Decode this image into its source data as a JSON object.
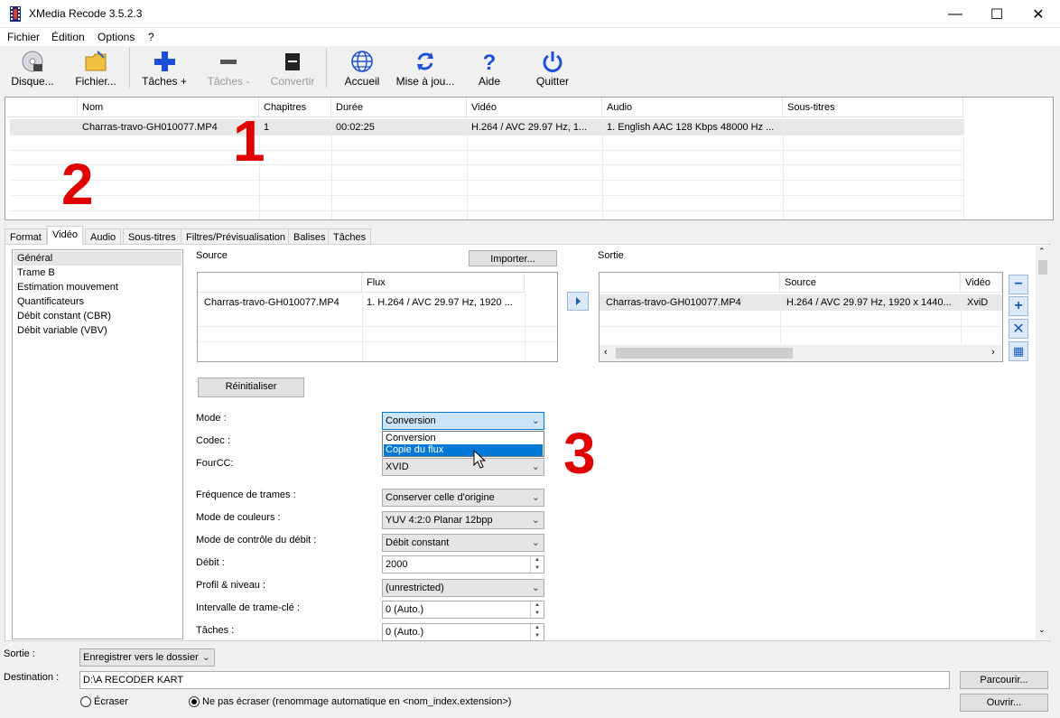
{
  "window": {
    "title": "XMedia Recode 3.5.2.3",
    "minimize": "—",
    "maximize": "☐",
    "close": "✕"
  },
  "menu": [
    "Fichier",
    "Édition",
    "Options",
    "?"
  ],
  "toolbar": {
    "disc": "Disque...",
    "file": "Fichier...",
    "add_task": "Tâches +",
    "remove_task": "Tâches -",
    "convert": "Convertir",
    "home": "Accueil",
    "update": "Mise à jou...",
    "help": "Aide",
    "quit": "Quitter"
  },
  "filelist": {
    "headers": [
      "Nom",
      "Chapitres",
      "Durée",
      "Vidéo",
      "Audio",
      "Sous-titres"
    ],
    "rows": [
      [
        "Charras-travo-GH010077.MP4",
        "1",
        "00:02:25",
        "H.264 / AVC  29.97 Hz, 1...",
        "1. English AAC  128 Kbps 48000 Hz ...",
        ""
      ]
    ]
  },
  "annotations": {
    "one": "1",
    "two": "2",
    "three": "3"
  },
  "tabs": [
    "Format",
    "Vidéo",
    "Audio",
    "Sous-titres",
    "Filtres/Prévisualisation",
    "Balises",
    "Tâches"
  ],
  "active_tab": "Vidéo",
  "left_list": [
    "Général",
    "Trame B",
    "Estimation mouvement",
    "Quantificateurs",
    "Débit constant (CBR)",
    "Débit variable (VBV)"
  ],
  "source": {
    "label": "Source",
    "import_button": "Importer...",
    "header_flux": "Flux",
    "row_name": "Charras-travo-GH010077.MP4",
    "row_flux": "1. H.264 / AVC  29.97 Hz, 1920 ..."
  },
  "output": {
    "label": "Sortie",
    "header_source": "Source",
    "header_video": "Vidéo",
    "row_name": "Charras-travo-GH010077.MP4",
    "row_source": "H.264 / AVC  29.97 Hz, 1920 x 1440...",
    "row_video": "XviD"
  },
  "reset_button": "Réinitialiser",
  "settings": {
    "mode_label": "Mode :",
    "mode_value": "Conversion",
    "mode_options": [
      "Conversion",
      "Copie du flux"
    ],
    "codec_label": "Codec :",
    "fourcc_label": "FourCC:",
    "fourcc_value": "XVID",
    "framerate_label": "Fréquence de trames :",
    "framerate_value": "Conserver celle d'origine",
    "colormode_label": "Mode de couleurs :",
    "colormode_value": "YUV 4:2:0 Planar 12bpp",
    "ratecontrol_label": "Mode de contrôle du débit :",
    "ratecontrol_value": "Débit constant",
    "bitrate_label": "Débit :",
    "bitrate_value": "2000",
    "profile_label": "Profil & niveau :",
    "profile_value": "(unrestricted)",
    "keyframe_label": "Intervalle de trame-clé :",
    "keyframe_value": "0 (Auto.)",
    "threads_label": "Tâches :",
    "threads_value": "0 (Auto.)"
  },
  "bottom": {
    "output_label": "Sortie :",
    "output_value": "Enregistrer vers le dossier",
    "dest_label": "Destination :",
    "dest_value": "D:\\A RECODER KART",
    "browse_button": "Parcourir...",
    "open_button": "Ouvrir...",
    "overwrite_label": "Écraser",
    "no_overwrite_label": "Ne pas écraser (renommage automatique en <nom_index.extension>)"
  },
  "colors": {
    "accent": "#0078d7",
    "annotation": "#e00000",
    "toolbar_blue": "#1d4fd8"
  }
}
